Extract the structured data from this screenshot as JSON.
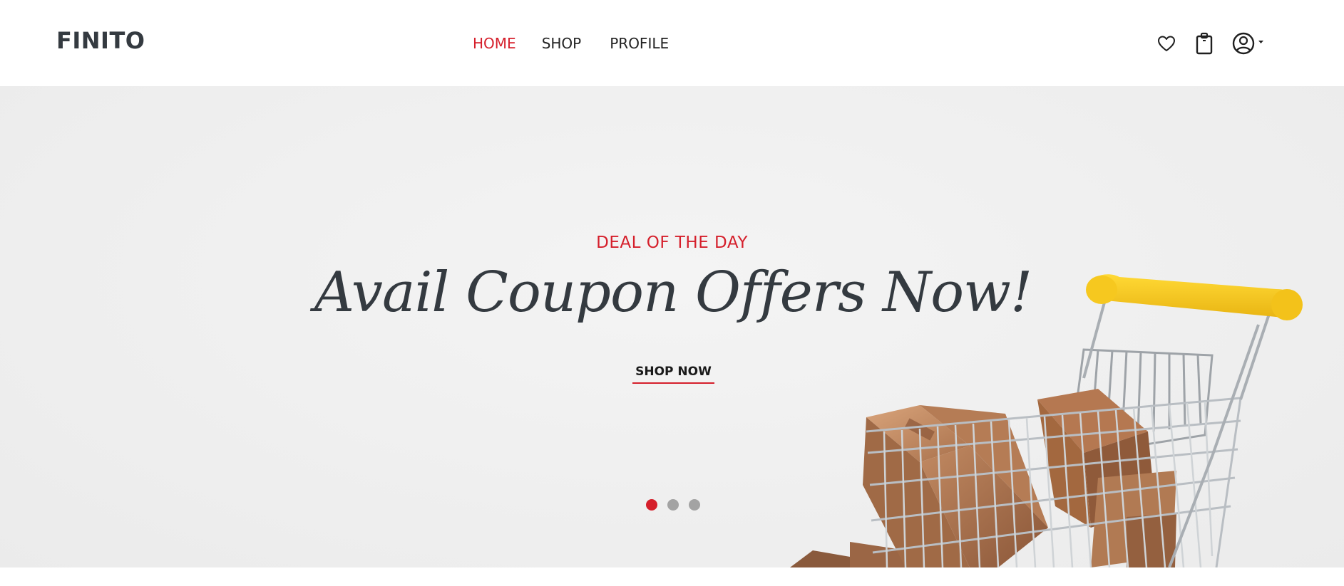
{
  "header": {
    "logo": "FINITO",
    "nav": [
      {
        "label": "HOME",
        "active": true
      },
      {
        "label": "SHOP",
        "active": false
      },
      {
        "label": "PROFILE",
        "active": false
      }
    ],
    "icons": [
      "heart-icon",
      "shopping-bag-icon",
      "user-circle-icon",
      "caret-down-icon"
    ]
  },
  "hero": {
    "eyebrow": "DEAL OF THE DAY",
    "title": "Avail Coupon Offers Now!",
    "cta": "SHOP NOW",
    "slides": 3,
    "active_slide": 1
  },
  "colors": {
    "accent": "#d51f2b",
    "text_dark": "#343a40",
    "dot_inactive": "#a3a3a3",
    "cart_handle": "#f2c21b",
    "box": "#c08a62"
  }
}
